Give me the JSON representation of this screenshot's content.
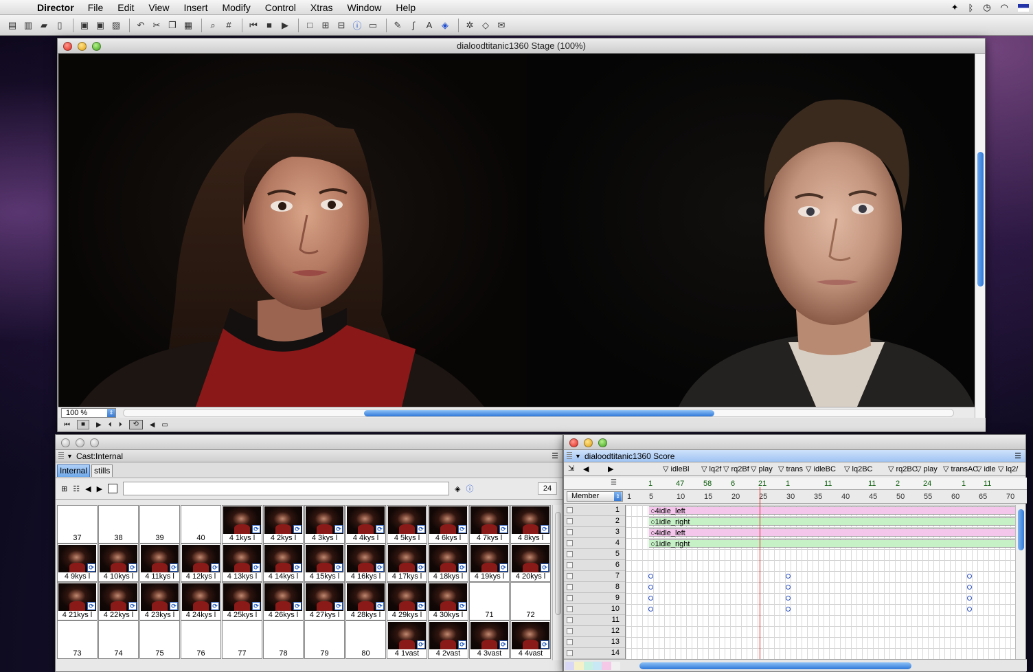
{
  "menubar": {
    "app_name": "Director",
    "items": [
      "File",
      "Edit",
      "View",
      "Insert",
      "Modify",
      "Control",
      "Xtras",
      "Window",
      "Help"
    ]
  },
  "stage": {
    "title": "dialoodtitanic1360 Stage (100%)",
    "zoom": "100 %"
  },
  "cast": {
    "title": "Cast:Internal",
    "tabs": [
      "Internal",
      "stills"
    ],
    "member_number": "24",
    "members": [
      {
        "label": "37",
        "thumb": false
      },
      {
        "label": "38",
        "thumb": false
      },
      {
        "label": "39",
        "thumb": false
      },
      {
        "label": "40",
        "thumb": false
      },
      {
        "label": "4 1kys l",
        "thumb": true
      },
      {
        "label": "4 2kys l",
        "thumb": true
      },
      {
        "label": "4 3kys l",
        "thumb": true
      },
      {
        "label": "4 4kys l",
        "thumb": true
      },
      {
        "label": "4 5kys l",
        "thumb": true
      },
      {
        "label": "4 6kys l",
        "thumb": true
      },
      {
        "label": "4 7kys l",
        "thumb": true
      },
      {
        "label": "4 8kys l",
        "thumb": true
      },
      {
        "label": "4 9kys l",
        "thumb": true
      },
      {
        "label": "4 10kys l",
        "thumb": true
      },
      {
        "label": "4 11kys l",
        "thumb": true
      },
      {
        "label": "4 12kys l",
        "thumb": true
      },
      {
        "label": "4 13kys l",
        "thumb": true
      },
      {
        "label": "4 14kys l",
        "thumb": true
      },
      {
        "label": "4 15kys l",
        "thumb": true
      },
      {
        "label": "4 16kys l",
        "thumb": true
      },
      {
        "label": "4 17kys l",
        "thumb": true
      },
      {
        "label": "4 18kys l",
        "thumb": true
      },
      {
        "label": "4 19kys l",
        "thumb": true
      },
      {
        "label": "4 20kys l",
        "thumb": true
      },
      {
        "label": "4 21kys l",
        "thumb": true
      },
      {
        "label": "4 22kys l",
        "thumb": true
      },
      {
        "label": "4 23kys l",
        "thumb": true
      },
      {
        "label": "4 24kys l",
        "thumb": true
      },
      {
        "label": "4 25kys l",
        "thumb": true
      },
      {
        "label": "4 26kys l",
        "thumb": true
      },
      {
        "label": "4 27kys l",
        "thumb": true
      },
      {
        "label": "4 28kys l",
        "thumb": true
      },
      {
        "label": "4 29kys l",
        "thumb": true
      },
      {
        "label": "4 30kys l",
        "thumb": true
      },
      {
        "label": "71",
        "thumb": false
      },
      {
        "label": "72",
        "thumb": false
      },
      {
        "label": "73",
        "thumb": false
      },
      {
        "label": "74",
        "thumb": false
      },
      {
        "label": "75",
        "thumb": false
      },
      {
        "label": "76",
        "thumb": false
      },
      {
        "label": "77",
        "thumb": false
      },
      {
        "label": "78",
        "thumb": false
      },
      {
        "label": "79",
        "thumb": false
      },
      {
        "label": "80",
        "thumb": false
      },
      {
        "label": "4 1vast",
        "thumb": true
      },
      {
        "label": "4 2vast",
        "thumb": true
      },
      {
        "label": "4 3vast",
        "thumb": true
      },
      {
        "label": "4 4vast",
        "thumb": true
      }
    ]
  },
  "score": {
    "title": "dialoodtitanic1360 Score",
    "view_selector": "Member",
    "markers": [
      {
        "label": "idleBl",
        "frame": 4
      },
      {
        "label": "lq2f",
        "frame": 11
      },
      {
        "label": "rq2Bf",
        "frame": 15
      },
      {
        "label": "play",
        "frame": 20
      },
      {
        "label": "trans",
        "frame": 25
      },
      {
        "label": "idleBC",
        "frame": 30
      },
      {
        "label": "lq2BC",
        "frame": 37
      },
      {
        "label": "rq2BC",
        "frame": 45
      },
      {
        "label": "play",
        "frame": 50
      },
      {
        "label": "transAC",
        "frame": 55
      },
      {
        "label": "idle",
        "frame": 61
      },
      {
        "label": "lq2/",
        "frame": 65
      }
    ],
    "tempo_numbers": [
      {
        "label": "1",
        "frame": 5
      },
      {
        "label": "47",
        "frame": 10
      },
      {
        "label": "58",
        "frame": 15
      },
      {
        "label": "6",
        "frame": 20
      },
      {
        "label": "21",
        "frame": 25
      },
      {
        "label": "1",
        "frame": 30
      },
      {
        "label": "11",
        "frame": 37
      },
      {
        "label": "11",
        "frame": 45
      },
      {
        "label": "2",
        "frame": 50
      },
      {
        "label": "24",
        "frame": 55
      },
      {
        "label": "1",
        "frame": 62
      },
      {
        "label": "11",
        "frame": 66
      }
    ],
    "ruler": [
      "1",
      "5",
      "10",
      "15",
      "20",
      "25",
      "30",
      "35",
      "40",
      "45",
      "50",
      "55",
      "60",
      "65",
      "70"
    ],
    "playhead_frame": 25,
    "channels": [
      "1",
      "2",
      "3",
      "4",
      "5",
      "6",
      "7",
      "8",
      "9",
      "10",
      "11",
      "12",
      "13",
      "14"
    ],
    "sprites": [
      {
        "channel": 1,
        "label": "4idle_left",
        "color": "#f5c6ec"
      },
      {
        "channel": 2,
        "label": "1idle_right",
        "color": "#c6f0c6"
      },
      {
        "channel": 3,
        "label": "4idle_left",
        "color": "#f5c6ec"
      },
      {
        "channel": 4,
        "label": "1idle_right",
        "color": "#c6f0c6"
      }
    ],
    "keyframes": [
      {
        "channel": 7,
        "frame": 5
      },
      {
        "channel": 8,
        "frame": 5
      },
      {
        "channel": 9,
        "frame": 5
      },
      {
        "channel": 10,
        "frame": 5
      },
      {
        "channel": 7,
        "frame": 30
      },
      {
        "channel": 8,
        "frame": 30
      },
      {
        "channel": 9,
        "frame": 30
      },
      {
        "channel": 10,
        "frame": 30
      },
      {
        "channel": 7,
        "frame": 63
      },
      {
        "channel": 8,
        "frame": 63
      },
      {
        "channel": 9,
        "frame": 63
      },
      {
        "channel": 10,
        "frame": 63
      }
    ]
  }
}
